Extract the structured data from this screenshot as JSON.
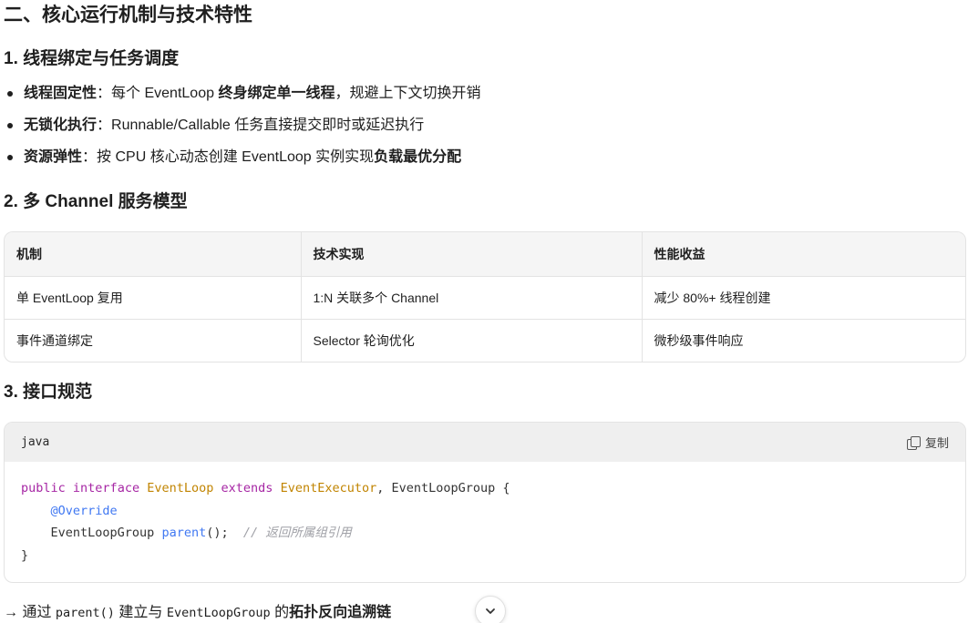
{
  "section_title": "二、核心运行机制与技术特性",
  "sub1": {
    "title": "1. 线程绑定与任务调度",
    "bullets": [
      {
        "bold": "线程固定性",
        "sep": "：",
        "text1": "每个 EventLoop ",
        "bold2": "终身绑定单一线程",
        "text2": "，规避上下文切换开销"
      },
      {
        "bold": "无锁化执行",
        "sep": "：",
        "text1": "Runnable/Callable 任务直接提交即时或延迟执行",
        "bold2": "",
        "text2": ""
      },
      {
        "bold": "资源弹性",
        "sep": "：",
        "text1": "按 CPU 核心动态创建 EventLoop 实例实现",
        "bold2": "负载最优分配",
        "text2": ""
      }
    ]
  },
  "sub2": {
    "title": "2. 多 Channel 服务模型",
    "headers": [
      "机制",
      "技术实现",
      "性能收益"
    ],
    "rows": [
      [
        "单 EventLoop 复用",
        "1:N 关联多个 Channel",
        "减少 80%+ 线程创建"
      ],
      [
        "事件通道绑定",
        "Selector 轮询优化",
        "微秒级事件响应"
      ]
    ]
  },
  "sub3": {
    "title": "3. 接口规范",
    "code": {
      "lang": "java",
      "copy_label": "复制",
      "tokens": {
        "public": "public",
        "interface": "interface",
        "name": "EventLoop",
        "extends": "extends",
        "parent1": "EventExecutor",
        "comma": ", EventLoopGroup {",
        "override": "@Override",
        "ret": "EventLoopGroup ",
        "method": "parent",
        "call": "();",
        "comment": "// 返回所属组引用",
        "close": "}"
      }
    }
  },
  "footer": {
    "arrow": "→ 通过 ",
    "code1": "parent()",
    "mid": " 建立与 ",
    "code2": "EventLoopGroup",
    "mid2": " 的",
    "bold": "拓扑反向追溯链"
  },
  "icons": {
    "copy": "copy-icon",
    "scroll": "chevron-down-icon"
  }
}
